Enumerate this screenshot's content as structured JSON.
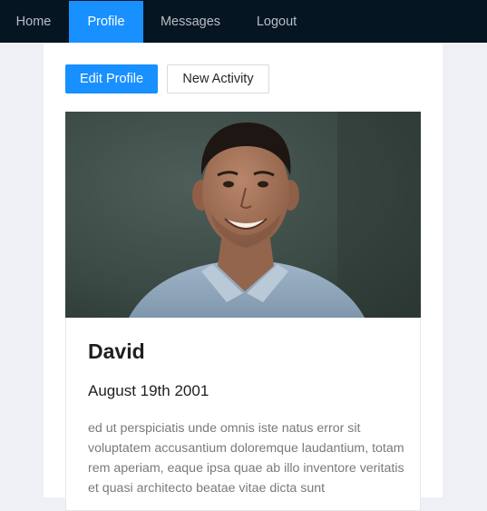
{
  "nav": {
    "items": [
      {
        "label": "Home",
        "active": false
      },
      {
        "label": "Profile",
        "active": true
      },
      {
        "label": "Messages",
        "active": false
      },
      {
        "label": "Logout",
        "active": false
      }
    ]
  },
  "toolbar": {
    "edit_profile_label": "Edit Profile",
    "new_activity_label": "New Activity"
  },
  "profile": {
    "name": "David",
    "birthdate": "August 19th 2001",
    "bio": "ed ut perspiciatis unde omnis iste natus error sit voluptatem accusantium doloremque laudantium, totam rem aperiam, eaque ipsa quae ab illo inventore veritatis et quasi architecto beatae vitae dicta sunt"
  },
  "colors": {
    "nav_bg": "#061522",
    "accent": "#1890ff",
    "page_bg": "#eef0f5"
  }
}
